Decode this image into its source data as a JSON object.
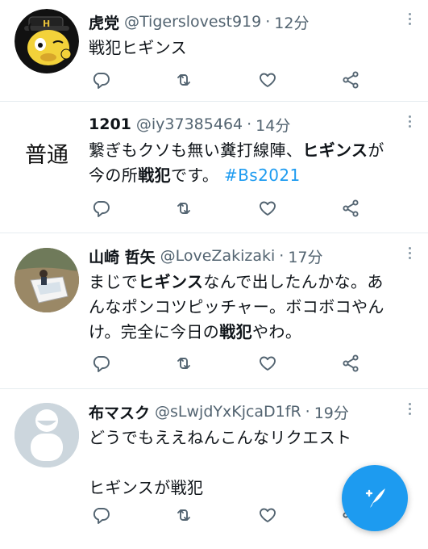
{
  "tweets": [
    {
      "name": "虎党",
      "handle": "@Tigerslovest919",
      "time": "12分",
      "lines": [
        [
          {
            "text": "戦犯ヒギンス",
            "style": "normal"
          }
        ]
      ]
    },
    {
      "name": "1201",
      "handle": "@iy37385464",
      "time": "14分",
      "avatar_text": "普通",
      "lines": [
        [
          {
            "text": "繋ぎもクソも無い糞打線陣、",
            "style": "normal"
          },
          {
            "text": "ヒギンス",
            "style": "bold"
          },
          {
            "text": "が",
            "style": "normal"
          }
        ],
        [
          {
            "text": "今の所",
            "style": "normal"
          },
          {
            "text": "戦犯",
            "style": "bold"
          },
          {
            "text": "です。 ",
            "style": "normal"
          },
          {
            "text": "#Bs2021",
            "style": "hashtag"
          }
        ]
      ]
    },
    {
      "name": "山崎 哲矢",
      "handle": "@LoveZakizaki",
      "time": "17分",
      "lines": [
        [
          {
            "text": "まじで",
            "style": "normal"
          },
          {
            "text": "ヒギンス",
            "style": "bold"
          },
          {
            "text": "なんで出したんかな。あ",
            "style": "normal"
          }
        ],
        [
          {
            "text": "んなポンコツピッチャー。ボコボコやん",
            "style": "normal"
          }
        ],
        [
          {
            "text": "け。完全に今日の",
            "style": "normal"
          },
          {
            "text": "戦犯",
            "style": "bold"
          },
          {
            "text": "やわ。",
            "style": "normal"
          }
        ]
      ]
    },
    {
      "name": "布マスク",
      "handle": "@sLwjdYxKjcaD1fR",
      "time": "19分",
      "lines": [
        [
          {
            "text": "どうでもええねんこんなリクエスト",
            "style": "normal"
          }
        ],
        [],
        [
          {
            "text": "ヒギンスが戦犯",
            "style": "normal"
          }
        ]
      ]
    }
  ],
  "colors": {
    "accent": "#1d9bf0",
    "text": "#0f1419",
    "secondary": "#536471",
    "divider": "#e6ecf0"
  },
  "icons": {
    "actions": [
      "reply-icon",
      "retweet-icon",
      "like-icon",
      "share-icon"
    ],
    "fab": "compose-tweet-icon"
  }
}
